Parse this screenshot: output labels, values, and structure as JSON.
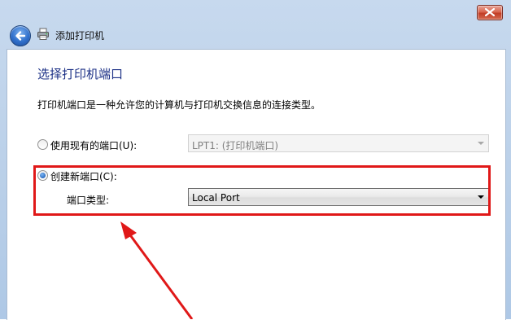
{
  "window": {
    "title": "添加打印机",
    "accent_red": "#e01818"
  },
  "page": {
    "heading": "选择打印机端口",
    "description": "打印机端口是一种允许您的计算机与打印机交换信息的连接类型。"
  },
  "options": {
    "use_existing": {
      "label": "使用现有的端口(U):",
      "selected": false,
      "combo_value": "LPT1: (打印机端口)"
    },
    "create_new": {
      "label": "创建新端口(C):",
      "selected": true,
      "port_type_label": "端口类型:",
      "combo_value": "Local Port"
    }
  }
}
